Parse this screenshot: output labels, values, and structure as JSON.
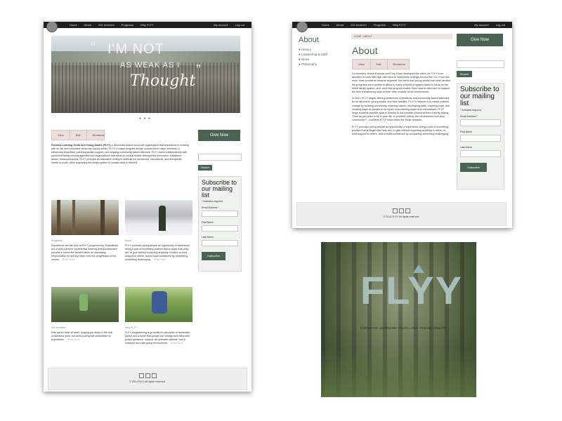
{
  "nav": {
    "items": [
      "Home",
      "About",
      "Get Involved",
      "Programs",
      "Why FLYY"
    ],
    "right": [
      "My account",
      "Log out"
    ]
  },
  "home": {
    "hero_text": [
      "I'M NOT",
      "AS WEAK AS I",
      "Thought"
    ],
    "tabs": [
      "View",
      "Edit",
      "Revisions"
    ],
    "intro_bold": "Forward Learning Youth and Young Adults (FLYY)",
    "intro": " a Wisconsin-based non-profit organization that specializes in working with at-risk and vulnerable teens and young adults. FLYY's unique program design couples three major elements: a wilderness expedition, parent/guardian support, and ongoing community-based aftercare. FLYY works collaboratively with youth and family-serving agencies and organizations that focus on mental health, delinquency prevention, substance abuse, truancy/dropouts. FLYY provides an adjunctive setting to address the behavioral, educational, and therapeutic needs of youth, while supporting the family system to sustain what is learned.",
    "give_now": "Give Now",
    "search_btn": "Search",
    "subscribe": {
      "title": "Subscribe to our mailing list",
      "required": "* indicates required",
      "email": "Email Address *",
      "first": "First Name",
      "last": "Last Name",
      "button": "Subscribe"
    },
    "cards": [
      {
        "title": "Programs",
        "text": "Expeditions are the core of FLYY programming. Expeditions are a multi-element, experiential learning and development process in which the student takes on increasing responsibility for self and team over the progression of the course.",
        "more": "...Read More"
      },
      {
        "title": "About",
        "text": "FLYY provides young people an opportunity to experience being a part of something positive that is larger than they are, to give without expecting anything in return, to lend support to others, and to build confidence by completing something challenging.",
        "more": "...Read More"
      },
      {
        "title": "Get Involved",
        "text": "Kitty ipsum dolor sit amet, judging you sleep in the sink consectetur justo, eat awful pulling bat consectetur at superdeles.",
        "more": "...Read More"
      },
      {
        "title": "Why FLYY",
        "text": "FLYY programming is grounded in principles of restorative justice and a belief that people can change their lives with proper guidance, support, an optimistic attitude, and a cohesive and safe group environment.",
        "more": "...Read More"
      }
    ],
    "footer": "© 2014 FLYY All rights reserved."
  },
  "about": {
    "breadcrumb": [
      "HOME",
      "ABOUT"
    ],
    "side_title": "About",
    "side_items": [
      "History",
      "Leadership & Staff",
      "News",
      "Philosophy"
    ],
    "title": "About",
    "tabs": [
      "View",
      "Edit",
      "Revisions"
    ],
    "paras": [
      "Co-founders Jessie Kushner and Troy Gosz developed the vision for FLYY from decades of work with high-risk teens in wilderness settings around the U.S. From this work, three problems became apparent: the teens and young adults that most needed the programs were unable to afford it; many of these programs failed to focus on the entire family system; and, once the program ended, there was no aftercare to support the teen transitioning back to their often-chaotic home environment.",
      "In 2011, FLYY began offering wilderness expeditions and community-based aftercare for at-risk teens, young adults, and their families. FLYY's mission is to create positive change by building community, teaching values, developing skills, inspiring hope, and creating ways for people to be a part of something larger than themselves. FLYY helps students transfer what is learned to the broader context of their lives by asking: \"How do you want to be in your life; to yourself, others, the environment and your community?\"...And then FLYY helps them live those answers.",
      "FLYY provides young people an opportunity to experience being a part of something positive that is larger than they are, to give without expecting anything in return, to lend support to others, and to build confidence by completing something challenging."
    ],
    "give_now": "Give Now",
    "search_btn": "Search",
    "subscribe": {
      "title": "Subscribe to our mailing list",
      "required": "* indicates required",
      "email": "Email Address *",
      "first": "First Name",
      "last": "Last Name",
      "button": "Subscribe"
    },
    "footer": "© 2014 FLYY All rights reserved."
  },
  "logo_card": {
    "wordmark": "FLYY",
    "tagline": "FORWARD LEARNING YOUTH AND YOUNG ADULTS"
  }
}
